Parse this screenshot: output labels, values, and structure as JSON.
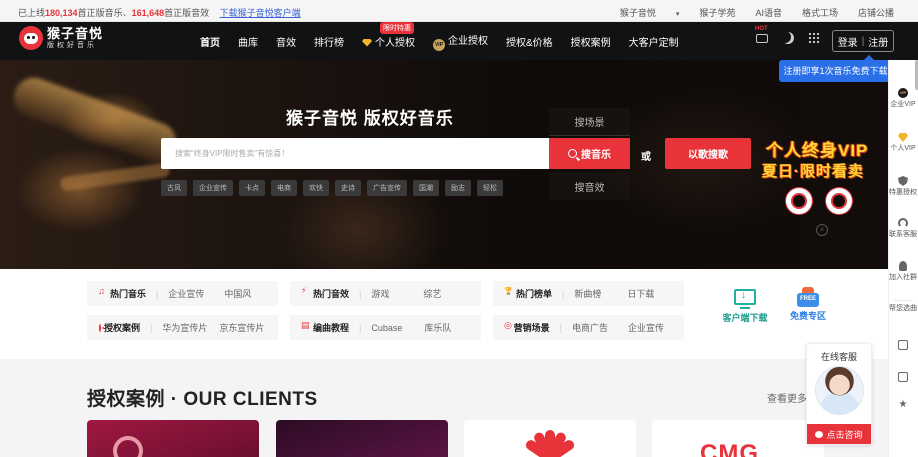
{
  "topbar": {
    "prefix": "已上线",
    "music_count": "180,134",
    "music_label": "首正版音乐、",
    "sfx_count": "161,648",
    "sfx_label": "首正版音效",
    "download_link": "下载猴子音悦客户端",
    "links": [
      "猴子音悦",
      "猴子学苑",
      "AI语音",
      "格式工场",
      "店铺公播"
    ]
  },
  "nav": {
    "logo_title": "猴子音悦",
    "logo_sub": "版权好音乐",
    "items": [
      "首页",
      "曲库",
      "音效",
      "排行榜",
      "个人授权",
      "企业授权",
      "授权&价格",
      "授权案例",
      "大客户定制"
    ],
    "hot_tag": "限时特惠",
    "vip_badge": "VIP",
    "hot_mini": "HOT",
    "login": "登录",
    "register": "注册"
  },
  "register_tip": "注册即享1次音乐免费下载",
  "hero": {
    "title": "猴子音悦 版权好音乐",
    "search_placeholder": "搜索“终身VIP限时售卖”有惊喜！",
    "search_button": "搜音乐",
    "option_top": "搜场景",
    "option_bottom": "搜音效",
    "or": "或",
    "song_search": "以歌搜歌",
    "tags": [
      "古风",
      "企业宣传",
      "卡点",
      "电商",
      "欢快",
      "史诗",
      "广告宣传",
      "国潮",
      "励志",
      "轻松"
    ],
    "promo_line1": "个人终身VIP",
    "promo_line2": "夏日·限时看卖"
  },
  "categories": {
    "rows": [
      [
        {
          "icon": "music-note-icon",
          "title": "热门音乐",
          "links": [
            "企业宣传",
            "中国风"
          ]
        },
        {
          "icon": "lightning-icon",
          "title": "热门音效",
          "links": [
            "游戏",
            "综艺"
          ]
        },
        {
          "icon": "trophy-icon",
          "title": "热门榜单",
          "links": [
            "新曲榜",
            "日下载"
          ]
        }
      ],
      [
        {
          "icon": "case-icon",
          "title": "授权案例",
          "links": [
            "华为宣传片",
            "京东宣传片"
          ]
        },
        {
          "icon": "book-icon",
          "title": "编曲教程",
          "links": [
            "Cubase",
            "库乐队"
          ]
        },
        {
          "icon": "target-icon",
          "title": "营销场景",
          "links": [
            "电商广告",
            "企业宣传"
          ]
        }
      ]
    ],
    "client_download": "客户端下载",
    "free_zone": "免费专区",
    "free_badge": "FREE"
  },
  "clients": {
    "title": "授权案例 · OUR CLIENTS",
    "view_more": "查看更多",
    "card4_logo": "CMG"
  },
  "rail": {
    "items": [
      {
        "icon": "vip-icon",
        "label": "企业VIP",
        "glyph": "VIP"
      },
      {
        "icon": "diamond-icon",
        "label": "个人VIP"
      },
      {
        "icon": "shield-icon",
        "label": "特惠授权"
      },
      {
        "icon": "headset-icon",
        "label": "联系客服"
      },
      {
        "icon": "person-icon",
        "label": "加入社群"
      },
      {
        "icon": "help-icon",
        "label": "帮您选曲"
      },
      {
        "icon": "chat-icon",
        "label": ""
      },
      {
        "icon": "message-icon",
        "label": ""
      },
      {
        "icon": "star-icon",
        "label": ""
      }
    ]
  },
  "customer_service": {
    "title": "在线客服",
    "button": "点击咨询"
  },
  "colors": {
    "accent": "#e8333a",
    "nav_bg": "#111214",
    "tip_blue": "#2b6fe8",
    "download_teal": "#1f9c8f"
  }
}
